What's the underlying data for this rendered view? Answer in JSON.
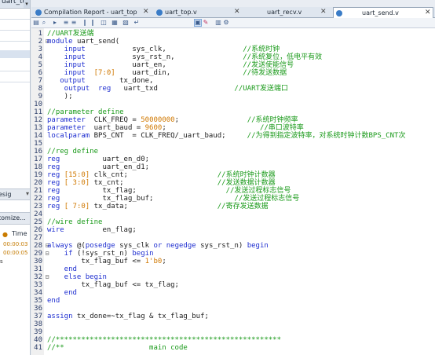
{
  "left_panel": {
    "title": "uart_top",
    "search_strip": "esig",
    "customize_strip": "tomize...",
    "time_header": "Time",
    "times": [
      "00:00:03",
      "00:00:05"
    ],
    "s_label": "s"
  },
  "tabs": [
    {
      "label": "Compilation Report - uart_top",
      "active": false
    },
    {
      "label": "uart_top.v",
      "active": false
    },
    {
      "label": "uart_recv.v",
      "active": false
    },
    {
      "label": "uart_send.v",
      "active": true
    }
  ],
  "toolbar_icons": [
    "open-icon",
    "find-icon",
    "bookmark-icon",
    "indent-icon",
    "outdent-icon",
    "comment-icon",
    "uncomment-icon",
    "template-icon",
    "block-icon",
    "insert-icon",
    "wrap-icon",
    "format-icon",
    "pin-icon",
    "calc-icon",
    "settings-icon"
  ],
  "code_lines": [
    {
      "n": "1",
      "fold": "",
      "tokens": [
        {
          "t": "//UART发送端",
          "c": "cm"
        }
      ]
    },
    {
      "n": "2",
      "fold": "⊟",
      "tokens": [
        {
          "t": "module ",
          "c": "kw"
        },
        {
          "t": "uart_send(",
          "c": "id"
        }
      ]
    },
    {
      "n": "3",
      "fold": "",
      "tokens": [
        {
          "t": "    input",
          "c": "kw"
        },
        {
          "t": "           sys_clk,                  ",
          "c": "id"
        },
        {
          "t": "//系统时钟",
          "c": "cm"
        }
      ]
    },
    {
      "n": "4",
      "fold": "",
      "tokens": [
        {
          "t": "    input",
          "c": "kw"
        },
        {
          "t": "           sys_rst_n,                ",
          "c": "id"
        },
        {
          "t": "//系统复位，低电平有效",
          "c": "cm"
        }
      ]
    },
    {
      "n": "5",
      "fold": "",
      "tokens": [
        {
          "t": "    input",
          "c": "kw"
        },
        {
          "t": "           uart_en,                  ",
          "c": "id"
        },
        {
          "t": "//发送使能信号",
          "c": "cm"
        }
      ]
    },
    {
      "n": "6",
      "fold": "",
      "tokens": [
        {
          "t": "    input",
          "c": "kw"
        },
        {
          "t": "  [7:0]",
          "c": "num"
        },
        {
          "t": "    uart_din,                 ",
          "c": "id"
        },
        {
          "t": "//待发送数据",
          "c": "cm"
        }
      ]
    },
    {
      "n": "7",
      "fold": "",
      "tokens": [
        {
          "t": "   output",
          "c": "kw"
        },
        {
          "t": "        tx_done,",
          "c": "id"
        }
      ]
    },
    {
      "n": "8",
      "fold": "",
      "tokens": [
        {
          "t": "    output  reg",
          "c": "kw"
        },
        {
          "t": "   uart_txd                  ",
          "c": "id"
        },
        {
          "t": "//UART发送端口",
          "c": "cm"
        }
      ]
    },
    {
      "n": "9",
      "fold": "",
      "tokens": [
        {
          "t": "    );",
          "c": "id"
        }
      ]
    },
    {
      "n": "10",
      "fold": "",
      "tokens": []
    },
    {
      "n": "11",
      "fold": "",
      "tokens": [
        {
          "t": "//parameter define",
          "c": "cm"
        }
      ]
    },
    {
      "n": "12",
      "fold": "",
      "tokens": [
        {
          "t": "parameter",
          "c": "kw"
        },
        {
          "t": "  CLK_FREQ = ",
          "c": "id"
        },
        {
          "t": "50000000",
          "c": "num"
        },
        {
          "t": ";                ",
          "c": "id"
        },
        {
          "t": "//系统时钟频率",
          "c": "cm"
        }
      ]
    },
    {
      "n": "13",
      "fold": "",
      "tokens": [
        {
          "t": "parameter",
          "c": "kw"
        },
        {
          "t": "  uart_baud = ",
          "c": "id"
        },
        {
          "t": "9600",
          "c": "num"
        },
        {
          "t": ";                      ",
          "c": "id"
        },
        {
          "t": "//串口波特率",
          "c": "cm"
        }
      ]
    },
    {
      "n": "14",
      "fold": "",
      "tokens": [
        {
          "t": "localparam",
          "c": "kw"
        },
        {
          "t": " BPS_CNT  = CLK_FREQ/_uart_baud;     ",
          "c": "id"
        },
        {
          "t": "//为得到指定波特率，对系统时钟计数BPS_CNT次",
          "c": "cm"
        }
      ]
    },
    {
      "n": "15",
      "fold": "",
      "tokens": []
    },
    {
      "n": "16",
      "fold": "",
      "tokens": [
        {
          "t": "//reg define",
          "c": "cm"
        }
      ]
    },
    {
      "n": "17",
      "fold": "",
      "tokens": [
        {
          "t": "reg",
          "c": "kw"
        },
        {
          "t": "          uart_en_d0;",
          "c": "id"
        }
      ]
    },
    {
      "n": "18",
      "fold": "",
      "tokens": [
        {
          "t": "reg",
          "c": "kw"
        },
        {
          "t": "          uart_en_d1;",
          "c": "id"
        }
      ]
    },
    {
      "n": "19",
      "fold": "",
      "tokens": [
        {
          "t": "reg ",
          "c": "kw"
        },
        {
          "t": "[15:0]",
          "c": "num"
        },
        {
          "t": " clk_cnt;                     ",
          "c": "id"
        },
        {
          "t": "//系统时钟计数器",
          "c": "cm"
        }
      ]
    },
    {
      "n": "20",
      "fold": "",
      "tokens": [
        {
          "t": "reg ",
          "c": "kw"
        },
        {
          "t": "[ 3:0]",
          "c": "num"
        },
        {
          "t": " tx_cnt;                      ",
          "c": "id"
        },
        {
          "t": "//发送数据计数器",
          "c": "cm"
        }
      ]
    },
    {
      "n": "21",
      "fold": "",
      "tokens": [
        {
          "t": "reg",
          "c": "kw"
        },
        {
          "t": "          tx_flag;                     ",
          "c": "id"
        },
        {
          "t": "//发送过程标志信号",
          "c": "cm"
        }
      ]
    },
    {
      "n": "22",
      "fold": "",
      "tokens": [
        {
          "t": "reg",
          "c": "kw"
        },
        {
          "t": "          tx_flag_buf;                   ",
          "c": "id"
        },
        {
          "t": "//发送过程标志信号",
          "c": "cm"
        }
      ]
    },
    {
      "n": "23",
      "fold": "",
      "tokens": [
        {
          "t": "reg ",
          "c": "kw"
        },
        {
          "t": "[ 7:0]",
          "c": "num"
        },
        {
          "t": " tx_data;                     ",
          "c": "id"
        },
        {
          "t": "//寄存发送数据",
          "c": "cm"
        }
      ]
    },
    {
      "n": "24",
      "fold": "",
      "tokens": []
    },
    {
      "n": "25",
      "fold": "",
      "tokens": [
        {
          "t": "//wire define",
          "c": "cm"
        }
      ]
    },
    {
      "n": "26",
      "fold": "",
      "tokens": [
        {
          "t": "wire",
          "c": "kw"
        },
        {
          "t": "         en_flag;",
          "c": "id"
        }
      ]
    },
    {
      "n": "27",
      "fold": "",
      "tokens": []
    },
    {
      "n": "28",
      "fold": "⊟",
      "tokens": [
        {
          "t": "always ",
          "c": "kw"
        },
        {
          "t": "@(",
          "c": "id"
        },
        {
          "t": "posedge",
          "c": "kw"
        },
        {
          "t": " sys_clk ",
          "c": "id"
        },
        {
          "t": "or negedge",
          "c": "kw"
        },
        {
          "t": " sys_rst_n) ",
          "c": "id"
        },
        {
          "t": "begin",
          "c": "kw"
        }
      ]
    },
    {
      "n": "29",
      "fold": "⊟",
      "tokens": [
        {
          "t": "    if ",
          "c": "kw"
        },
        {
          "t": "(!sys_rst_n) ",
          "c": "id"
        },
        {
          "t": "begin",
          "c": "kw"
        }
      ]
    },
    {
      "n": "30",
      "fold": "",
      "tokens": [
        {
          "t": "        tx_flag_buf <= ",
          "c": "id"
        },
        {
          "t": "1'b0",
          "c": "num"
        },
        {
          "t": ";",
          "c": "id"
        }
      ]
    },
    {
      "n": "31",
      "fold": "",
      "tokens": [
        {
          "t": "    end",
          "c": "kw"
        }
      ]
    },
    {
      "n": "32",
      "fold": "⊟",
      "tokens": [
        {
          "t": "    else begin",
          "c": "kw"
        }
      ]
    },
    {
      "n": "33",
      "fold": "",
      "tokens": [
        {
          "t": "        tx_flag_buf <= tx_flag;",
          "c": "id"
        }
      ]
    },
    {
      "n": "34",
      "fold": "",
      "tokens": [
        {
          "t": "    end",
          "c": "kw"
        }
      ]
    },
    {
      "n": "35",
      "fold": "",
      "tokens": [
        {
          "t": "end",
          "c": "kw"
        }
      ]
    },
    {
      "n": "36",
      "fold": "",
      "tokens": []
    },
    {
      "n": "37",
      "fold": "",
      "tokens": [
        {
          "t": "assign",
          "c": "kw"
        },
        {
          "t": " tx_done=~tx_flag & tx_flag_buf;",
          "c": "id"
        }
      ]
    },
    {
      "n": "38",
      "fold": "",
      "tokens": []
    },
    {
      "n": "39",
      "fold": "",
      "tokens": []
    },
    {
      "n": "40",
      "fold": "",
      "tokens": [
        {
          "t": "//*****************************************************",
          "c": "cm"
        }
      ]
    },
    {
      "n": "41",
      "fold": "",
      "tokens": [
        {
          "t": "//**                    main code",
          "c": "cm"
        }
      ]
    }
  ]
}
